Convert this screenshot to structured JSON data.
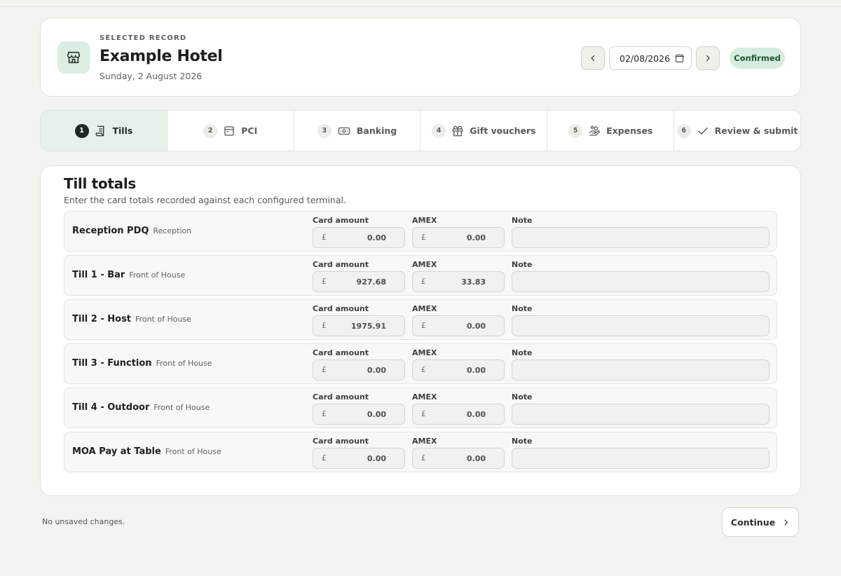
{
  "record": {
    "kicker": "SELECTED RECORD",
    "title": "Example Hotel",
    "date_long": "Sunday, 2 August 2026",
    "date_value": "02/08/2026",
    "status": "Confirmed",
    "icon": "store-icon"
  },
  "steps": [
    {
      "number": "1",
      "label": "Tills",
      "icon": "receipt-icon",
      "active": true
    },
    {
      "number": "2",
      "label": "PCI",
      "icon": "card-icon",
      "active": false
    },
    {
      "number": "3",
      "label": "Banking",
      "icon": "banknote-icon",
      "active": false
    },
    {
      "number": "4",
      "label": "Gift vouchers",
      "icon": "gift-icon",
      "active": false
    },
    {
      "number": "5",
      "label": "Expenses",
      "icon": "hand-coins-icon",
      "active": false
    },
    {
      "number": "6",
      "label": "Review & submit",
      "icon": "check-icon",
      "active": false
    }
  ],
  "panel": {
    "title": "Till totals",
    "subtitle": "Enter the card totals recorded against each configured terminal.",
    "labels": {
      "card": "Card amount",
      "amex": "AMEX",
      "note": "Note"
    },
    "currency": "£"
  },
  "terminals": [
    {
      "name": "Reception PDQ",
      "area": "Reception",
      "card": "0.00",
      "amex": "0.00",
      "note": ""
    },
    {
      "name": "Till 1 - Bar",
      "area": "Front of House",
      "card": "927.68",
      "amex": "33.83",
      "note": ""
    },
    {
      "name": "Till 2 - Host",
      "area": "Front of House",
      "card": "1975.91",
      "amex": "0.00",
      "note": ""
    },
    {
      "name": "Till 3 - Function",
      "area": "Front of House",
      "card": "0.00",
      "amex": "0.00",
      "note": ""
    },
    {
      "name": "Till 4 - Outdoor",
      "area": "Front of House",
      "card": "0.00",
      "amex": "0.00",
      "note": ""
    },
    {
      "name": "MOA Pay at Table",
      "area": "Front of House",
      "card": "0.00",
      "amex": "0.00",
      "note": ""
    }
  ],
  "footer": {
    "status": "No unsaved changes.",
    "continue_label": "Continue"
  },
  "colors": {
    "background": "#f3f4ef",
    "accent_soft": "#dbeee3",
    "badge_bg": "#d6ecde",
    "badge_text": "#1f5a35",
    "active_step": "#e6f1ea"
  }
}
